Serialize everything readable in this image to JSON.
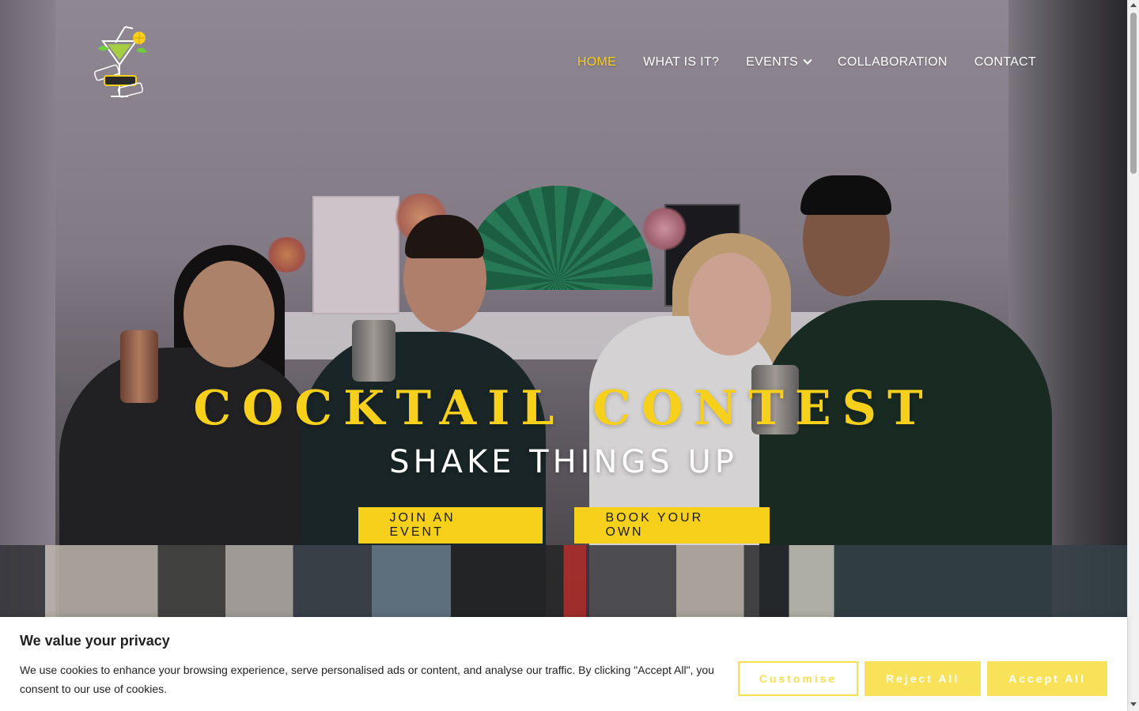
{
  "nav": {
    "items": [
      {
        "label": "HOME",
        "active": true
      },
      {
        "label": "WHAT IS IT?",
        "active": false
      },
      {
        "label": "EVENTS",
        "active": false,
        "has_dropdown": true
      },
      {
        "label": "COLLABORATION",
        "active": false
      },
      {
        "label": "CONTACT",
        "active": false
      }
    ]
  },
  "hero": {
    "title": "COCKTAIL CONTEST",
    "subtitle": "SHAKE THINGS UP",
    "buttons": {
      "join": "JOIN AN EVENT",
      "book": "BOOK YOUR OWN"
    }
  },
  "cookie": {
    "title": "We value your privacy",
    "text": "We use cookies to enhance your browsing experience, serve personalised ads or content, and analyse our traffic. By clicking \"Accept All\", you consent to our use of cookies.",
    "buttons": {
      "customise": "Customise",
      "reject": "Reject All",
      "accept": "Accept All"
    }
  },
  "colors": {
    "accent": "#f7d01b",
    "accent_light": "#f7e25a",
    "nav_text": "#ffffff",
    "banner_bg": "#ffffff"
  },
  "icons": {
    "logo": "cocktail-logo-icon",
    "dropdown": "chevron-down-icon"
  }
}
